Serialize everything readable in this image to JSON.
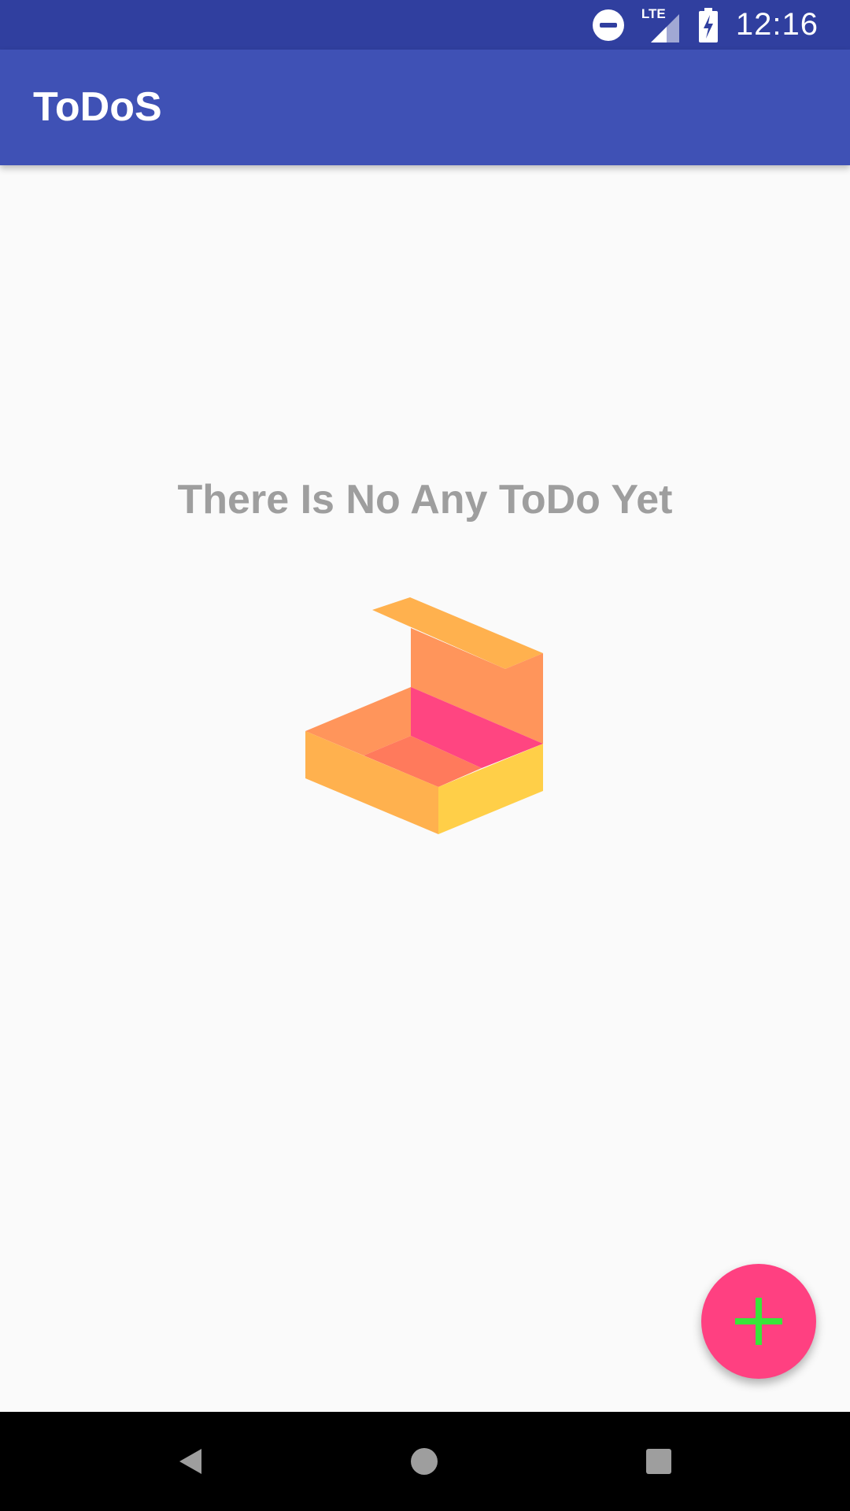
{
  "status_bar": {
    "time": "12:16",
    "network_type": "LTE",
    "icons": [
      "do-not-disturb-icon",
      "lte-signal-icon",
      "battery-charging-icon"
    ]
  },
  "app_bar": {
    "title": "ToDoS"
  },
  "empty_state": {
    "message": "There Is No Any ToDo Yet",
    "illustration": "open-box-icon"
  },
  "fab": {
    "icon": "plus-icon",
    "color": "#FF4081",
    "icon_color": "#39E639"
  },
  "navigation_bar": {
    "buttons": [
      "back-icon",
      "home-icon",
      "recents-icon"
    ]
  },
  "colors": {
    "primary_dark": "#303F9F",
    "primary": "#3F51B5",
    "accent": "#FF4081",
    "background": "#FAFAFA",
    "empty_text": "#9E9E9E"
  }
}
